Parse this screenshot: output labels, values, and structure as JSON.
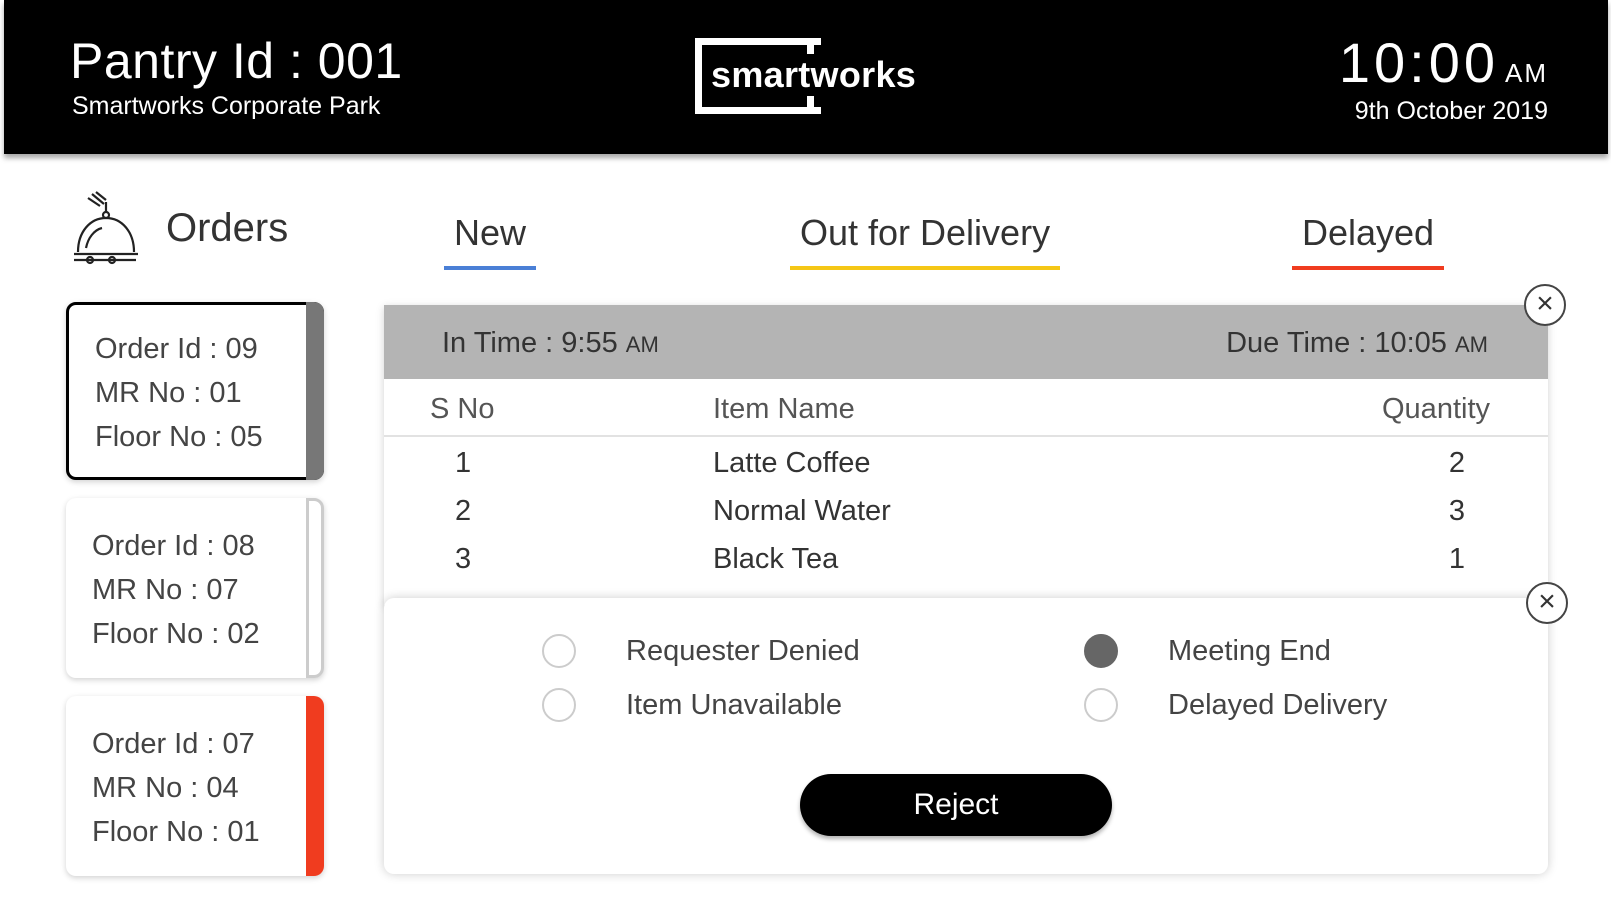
{
  "header": {
    "pantry_id": "Pantry Id : 001",
    "location": "Smartworks Corporate Park",
    "logo_text": "smartworks",
    "time": "10:00",
    "ampm": "AM",
    "date": "9th October 2019"
  },
  "orders": {
    "title": "Orders",
    "icon": "bell-icon"
  },
  "tabs": [
    {
      "label": "New",
      "color": "#4a7fd6"
    },
    {
      "label": "Out for Delivery",
      "color": "#f5c716"
    },
    {
      "label": "Delayed",
      "color": "#f03c1f"
    }
  ],
  "cards": [
    {
      "order_id": "Order Id : 09",
      "mr_no": "MR No : 01",
      "floor_no": "Floor No : 05",
      "status_color": "#777777"
    },
    {
      "order_id": "Order Id : 08",
      "mr_no": "MR No : 07",
      "floor_no": "Floor No : 02",
      "status_color": "#ffffff"
    },
    {
      "order_id": "Order Id : 07",
      "mr_no": "MR No : 04",
      "floor_no": "Floor No : 01",
      "status_color": "#f03c1f"
    }
  ],
  "detail": {
    "in_time_label": "In Time : 9:55",
    "in_time_ampm": "AM",
    "due_time_label": "Due Time : 10:05",
    "due_time_ampm": "AM",
    "columns": [
      "S No",
      "Item Name",
      "Quantity"
    ],
    "rows": [
      {
        "sno": "1",
        "item": "Latte Coffee",
        "qty": "2"
      },
      {
        "sno": "2",
        "item": "Normal Water",
        "qty": "3"
      },
      {
        "sno": "3",
        "item": "Black Tea",
        "qty": "1"
      }
    ]
  },
  "reject": {
    "options": [
      {
        "label": "Requester Denied",
        "checked": false
      },
      {
        "label": "Meeting End",
        "checked": true
      },
      {
        "label": "Item Unavailable",
        "checked": false
      },
      {
        "label": "Delayed Delivery",
        "checked": false
      }
    ],
    "button_label": "Reject"
  },
  "close_symbol": "×"
}
